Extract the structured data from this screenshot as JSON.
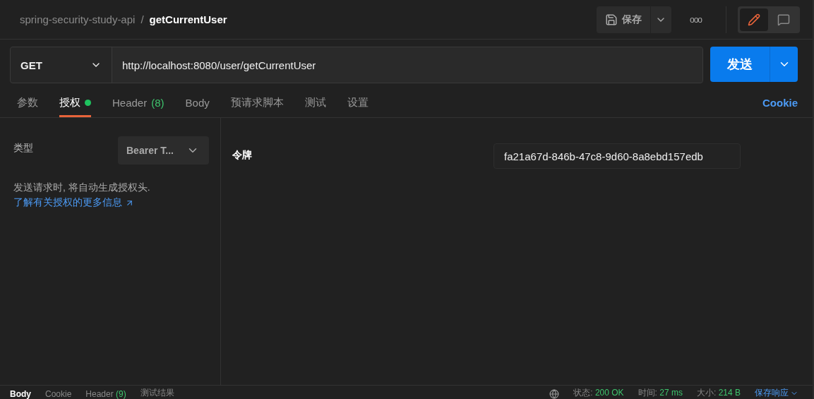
{
  "breadcrumb": {
    "collection": "spring-security-study-api",
    "separator": "/",
    "request": "getCurrentUser"
  },
  "toolbar": {
    "save_label": "保存",
    "more": "ooo",
    "modes": [
      {
        "kind": "edit",
        "selected": true
      },
      {
        "kind": "comments",
        "selected": false
      }
    ]
  },
  "request": {
    "method": "GET",
    "url": "http://localhost:8080/user/getCurrentUser",
    "send_label": "发送"
  },
  "tabs": [
    {
      "label": "参数",
      "selected": false,
      "indicator": false
    },
    {
      "label": "授权",
      "selected": true,
      "indicator": true
    },
    {
      "label": "Header",
      "count": "(8)",
      "selected": false,
      "indicator": false
    },
    {
      "label": "Body",
      "selected": false,
      "indicator": false
    },
    {
      "label": "预请求脚本",
      "selected": false,
      "indicator": false
    },
    {
      "label": "测试",
      "selected": false,
      "indicator": false
    },
    {
      "label": "设置",
      "selected": false,
      "indicator": false
    }
  ],
  "cookie_link": "Cookie",
  "auth": {
    "type_label": "类型",
    "type_value": "Bearer T...",
    "note": "发送请求时, 将自动生成授权头.",
    "learn_more": "了解有关授权的更多信息",
    "token_label": "令牌",
    "token_value": "fa21a67d-846b-47c8-9d60-8a8ebd157edb"
  },
  "response": {
    "tabs": [
      {
        "label": "Body",
        "selected": true
      },
      {
        "label": "Cookie",
        "selected": false
      },
      {
        "label": "Header",
        "count": "(9)",
        "selected": false
      },
      {
        "label": "测试结果",
        "selected": false
      }
    ],
    "stats": [
      {
        "label": "状态:",
        "value": "200 OK"
      },
      {
        "label": "时间:",
        "value": "27 ms"
      },
      {
        "label": "大小:",
        "value": "214 B"
      }
    ],
    "save_response": "保存响应"
  }
}
